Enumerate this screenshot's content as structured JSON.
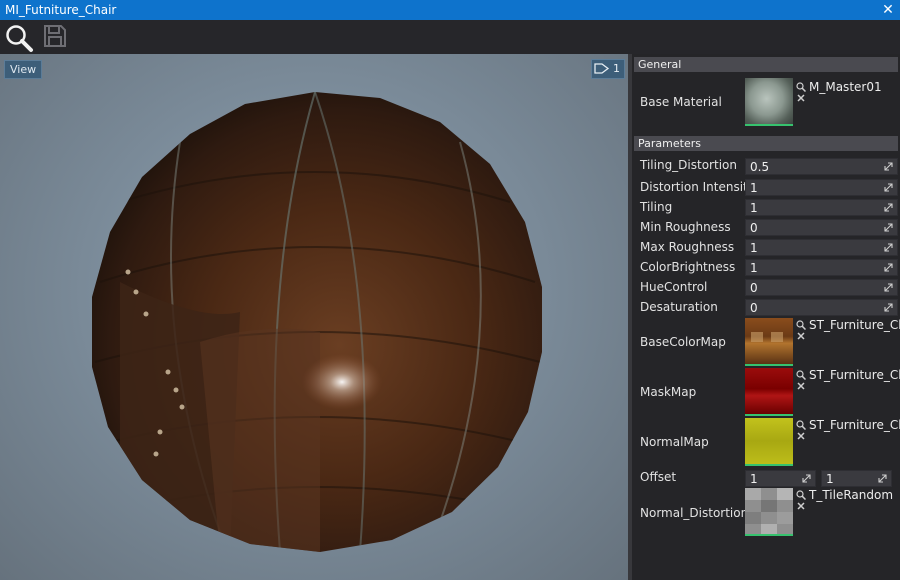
{
  "window": {
    "title": "MI_Futniture_Chair",
    "close_glyph": "✕"
  },
  "toolbar": {
    "search_icon": "search-icon",
    "save_icon": "save-icon"
  },
  "viewport": {
    "view_button_label": "View",
    "camera_speed": "1"
  },
  "panel": {
    "general_header": "General",
    "base_material_label": "Base Material",
    "base_material_value": "M_Master01",
    "parameters_header": "Parameters",
    "params": [
      {
        "label": "Tiling_Distortion",
        "value": "0.5"
      },
      {
        "label": "Distortion Intensity",
        "value": "1"
      },
      {
        "label": "Tiling",
        "value": "1"
      },
      {
        "label": "Min Roughness",
        "value": "0"
      },
      {
        "label": "Max Roughness",
        "value": "1"
      },
      {
        "label": "ColorBrightness",
        "value": "1"
      },
      {
        "label": "HueControl",
        "value": "0"
      },
      {
        "label": "Desaturation",
        "value": "0"
      }
    ],
    "textures": [
      {
        "label": "BaseColorMap",
        "asset": "ST_Furniture_Cha"
      },
      {
        "label": "MaskMap",
        "asset": "ST_Furniture_Cha"
      },
      {
        "label": "NormalMap",
        "asset": "ST_Furniture_Cha"
      }
    ],
    "offset": {
      "label": "Offset",
      "x": "1",
      "y": "1"
    },
    "normal_distortion": {
      "label": "Normal_Distortion",
      "asset": "T_TileRandom"
    }
  },
  "colors": {
    "titlebar": "#0e73cc",
    "accent_green": "#36c26e"
  }
}
